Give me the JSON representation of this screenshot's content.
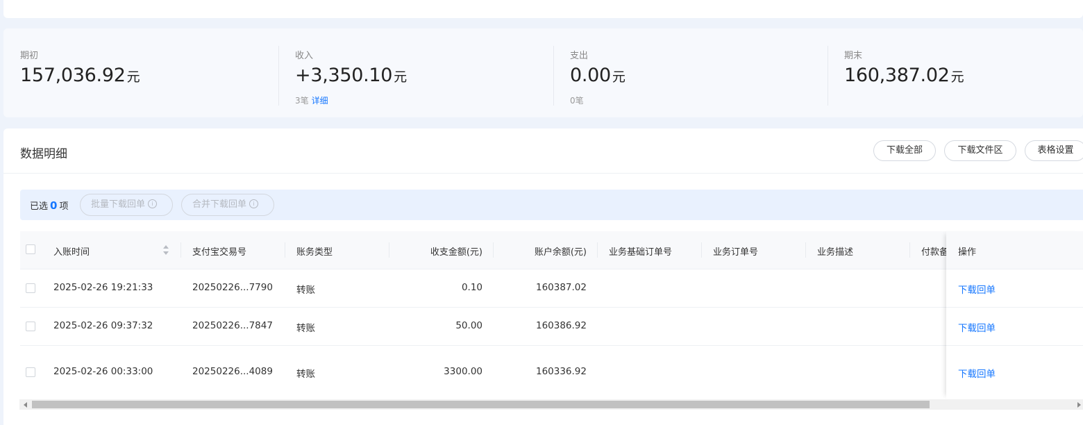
{
  "summary": [
    {
      "label": "期初",
      "amount": "157,036.92",
      "unit": "元",
      "sub": "",
      "sub_link": ""
    },
    {
      "label": "收入",
      "amount": "+3,350.10",
      "unit": "元",
      "sub": "3笔",
      "sub_link": "详细"
    },
    {
      "label": "支出",
      "amount": "0.00",
      "unit": "元",
      "sub": "0笔",
      "sub_link": ""
    },
    {
      "label": "期末",
      "amount": "160,387.02",
      "unit": "元",
      "sub": "",
      "sub_link": ""
    }
  ],
  "detail": {
    "title": "数据明细",
    "buttons": {
      "download_all": "下载全部",
      "download_area": "下载文件区",
      "table_settings": "表格设置"
    }
  },
  "selection": {
    "prefix": "已选",
    "count": "0",
    "suffix": "项",
    "batch_download": "批量下载回单",
    "merge_download": "合并下载回单",
    "info_glyph": "i"
  },
  "table": {
    "columns": {
      "time": "入账时间",
      "alipay_no": "支付宝交易号",
      "type": "账务类型",
      "amount": "收支金额(元)",
      "balance": "账户余额(元)",
      "base_order": "业务基础订单号",
      "order": "业务订单号",
      "desc": "业务描述",
      "payer": "付款备",
      "action": "操作"
    },
    "rows": [
      {
        "time": "2025-02-26 19:21:33",
        "alipay_no": "20250226...7790",
        "type": "转账",
        "amount": "0.10",
        "balance": "160387.02",
        "action": "下载回单"
      },
      {
        "time": "2025-02-26 09:37:32",
        "alipay_no": "20250226...7847",
        "type": "转账",
        "amount": "50.00",
        "balance": "160386.92",
        "action": "下载回单"
      },
      {
        "time": "2025-02-26 00:33:00",
        "alipay_no": "20250226...4089",
        "type": "转账",
        "amount": "3300.00",
        "balance": "160336.92",
        "action": "下载回单"
      }
    ]
  },
  "colors": {
    "accent": "#1677ff",
    "page_bg": "#eef3fb",
    "selbar_bg": "#e9f1fe"
  }
}
